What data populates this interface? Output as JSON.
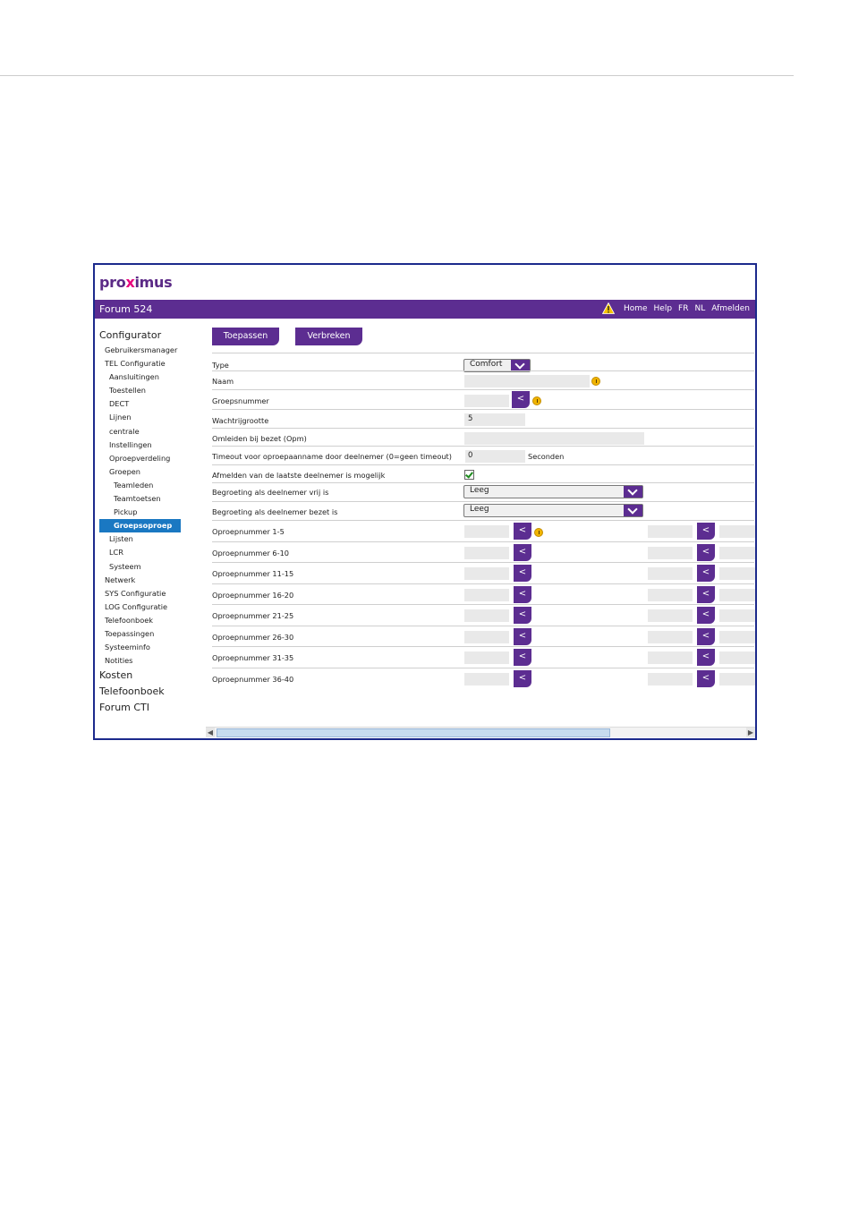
{
  "app": {
    "logo_left": "pro",
    "logo_x": "x",
    "logo_right": "imus",
    "title": "Forum 524"
  },
  "topnav": [
    "Home",
    "Help",
    "FR",
    "NL",
    "Afmelden"
  ],
  "sidebar": [
    {
      "label": "Configurator",
      "level": 0
    },
    {
      "label": "Gebruikersmanager",
      "level": 1
    },
    {
      "label": "TEL Configuratie",
      "level": 1
    },
    {
      "label": "Aansluitingen",
      "level": 2
    },
    {
      "label": "Toestellen",
      "level": 2
    },
    {
      "label": "DECT",
      "level": 2
    },
    {
      "label": "Lijnen",
      "level": 2
    },
    {
      "label": "centrale",
      "level": 2
    },
    {
      "label": "Instellingen",
      "level": 2
    },
    {
      "label": "Oproepverdeling",
      "level": 2
    },
    {
      "label": "Groepen",
      "level": 2
    },
    {
      "label": "Teamleden",
      "level": 3
    },
    {
      "label": "Teamtoetsen",
      "level": 3
    },
    {
      "label": "Pickup",
      "level": 3
    },
    {
      "label": "Groepsoproep",
      "level": 3,
      "active": true
    },
    {
      "label": "Lijsten",
      "level": 2
    },
    {
      "label": "LCR",
      "level": 2
    },
    {
      "label": "Systeem",
      "level": 2
    },
    {
      "label": "Netwerk",
      "level": 1
    },
    {
      "label": "SYS Configuratie",
      "level": 1
    },
    {
      "label": "LOG Configuratie",
      "level": 1
    },
    {
      "label": "Telefoonboek",
      "level": 1
    },
    {
      "label": "Toepassingen",
      "level": 1
    },
    {
      "label": "Systeeminfo",
      "level": 1
    },
    {
      "label": "Notities",
      "level": 1
    },
    {
      "label": "Kosten",
      "level": 0
    },
    {
      "label": "Telefoonboek",
      "level": 0
    },
    {
      "label": "Forum CTI",
      "level": 0
    }
  ],
  "buttons": {
    "apply": "Toepassen",
    "cancel": "Verbreken"
  },
  "form": {
    "type_label": "Type",
    "type_value": "Comfort",
    "naam_label": "Naam",
    "groepsnummer_label": "Groepsnummer",
    "wachtrij_label": "Wachtrijgrootte",
    "wachtrij_value": "5",
    "omleiden_label": "Omleiden bij bezet (Opm)",
    "timeout_label": "Timeout voor oproepaanname door deelnemer (0=geen timeout)",
    "timeout_value": "0",
    "timeout_unit": "Seconden",
    "afmelden_label": "Afmelden van de laatste deelnemer is mogelijk",
    "afmelden_checked": true,
    "begr_vrij_label": "Begroeting als deelnemer vrij is",
    "begr_vrij_value": "Leeg",
    "begr_bezet_label": "Begroeting als deelnemer bezet is",
    "begr_bezet_value": "Leeg",
    "arrow": "<",
    "oproep": [
      "Oproepnummer 1-5",
      "Oproepnummer 6-10",
      "Oproepnummer 11-15",
      "Oproepnummer 16-20",
      "Oproepnummer 21-25",
      "Oproepnummer 26-30",
      "Oproepnummer 31-35",
      "Oproepnummer 36-40"
    ]
  },
  "colors": {
    "brand": "#5c2d91",
    "active": "#1a78c2",
    "frame": "#1c2a8c"
  }
}
